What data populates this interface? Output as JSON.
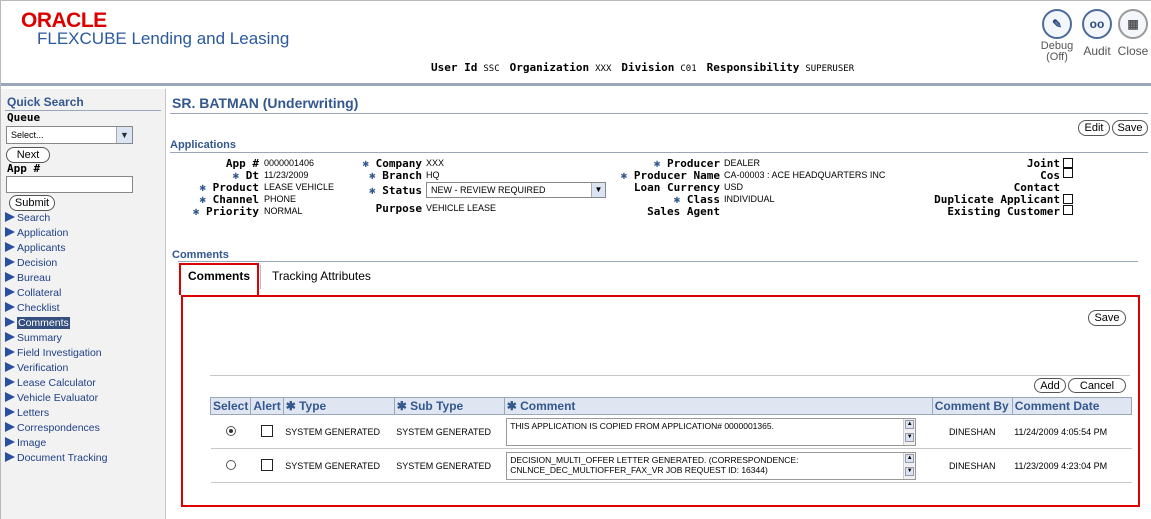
{
  "header": {
    "logo_brand": "ORACLE",
    "logo_product": "FLEXCUBE Lending and Leasing",
    "user_id_label": "User Id",
    "user_id_value": "SSC",
    "org_label": "Organization",
    "org_value": "XXX",
    "division_label": "Division",
    "division_value": "C01",
    "resp_label": "Responsibility",
    "resp_value": "SUPERUSER",
    "debug_label": "Debug",
    "debug_state": "(Off)",
    "audit_label": "Audit",
    "close_label": "Close"
  },
  "sidebar": {
    "title": "Quick Search",
    "queue_label": "Queue",
    "queue_value": "Select...",
    "next_label": "Next",
    "app_label": "App #",
    "app_value": "",
    "submit_label": "Submit",
    "items": [
      {
        "label": "Search"
      },
      {
        "label": "Application"
      },
      {
        "label": "Applicants"
      },
      {
        "label": "Decision"
      },
      {
        "label": "Bureau"
      },
      {
        "label": "Collateral"
      },
      {
        "label": "Checklist"
      },
      {
        "label": "Comments",
        "active": true
      },
      {
        "label": "Summary"
      },
      {
        "label": "Field Investigation"
      },
      {
        "label": "Verification"
      },
      {
        "label": "Lease Calculator"
      },
      {
        "label": "Vehicle Evaluator"
      },
      {
        "label": "Letters"
      },
      {
        "label": "Correspondences"
      },
      {
        "label": "Image"
      },
      {
        "label": "Document Tracking"
      }
    ]
  },
  "main": {
    "page_title": "SR. BATMAN (Underwriting)",
    "edit_label": "Edit",
    "save_label": "Save",
    "applications_title": "Applications",
    "fields": {
      "app_no_label": "App #",
      "app_no": "0000001406",
      "dt_label": "Dt",
      "dt": "11/23/2009",
      "product_label": "Product",
      "product": "LEASE VEHICLE",
      "channel_label": "Channel",
      "channel": "PHONE",
      "priority_label": "Priority",
      "priority": "NORMAL",
      "company_label": "Company",
      "company": "XXX",
      "branch_label": "Branch",
      "branch": "HQ",
      "status_label": "Status",
      "status": "NEW - REVIEW REQUIRED",
      "purpose_label": "Purpose",
      "purpose": "VEHICLE LEASE",
      "producer_label": "Producer",
      "producer": "DEALER",
      "producer_name_label": "Producer Name",
      "producer_name": "CA-00003 : ACE HEADQUARTERS INC",
      "loan_currency_label": "Loan Currency",
      "loan_currency": "USD",
      "class_label": "Class",
      "class": "INDIVIDUAL",
      "sales_agent_label": "Sales Agent",
      "joint_label": "Joint",
      "cos_label": "Cos",
      "contact_label": "Contact",
      "dup_label": "Duplicate Applicant",
      "existing_label": "Existing Customer"
    },
    "comments_title": "Comments",
    "tabs": [
      {
        "label": "Comments"
      },
      {
        "label": "Tracking Attributes"
      }
    ],
    "panel_save": "Save",
    "add_label": "Add",
    "cancel_label": "Cancel",
    "columns": {
      "select": "Select",
      "alert": "Alert",
      "type": "Type",
      "subtype": "Sub Type",
      "comment": "Comment",
      "by": "Comment By",
      "date": "Comment Date"
    },
    "rows": [
      {
        "type": "SYSTEM GENERATED",
        "subtype": "SYSTEM GENERATED",
        "comment": "THIS APPLICATION IS COPIED FROM APPLICATION# 0000001365.",
        "by": "DINESHAN",
        "date": "11/24/2009 4:05:54 PM",
        "selected": true
      },
      {
        "type": "SYSTEM GENERATED",
        "subtype": "SYSTEM GENERATED",
        "comment": "DECISION_MULTI_OFFER LETTER  GENERATED. (CORRESPONDENCE: CNLNCE_DEC_MULTIOFFER_FAX_VR JOB REQUEST ID: 16344)",
        "by": "DINESHAN",
        "date": "11/23/2009 4:23:04 PM",
        "selected": false
      }
    ]
  },
  "colors": {
    "accent": "#33578f",
    "highlight": "#dd0000"
  }
}
